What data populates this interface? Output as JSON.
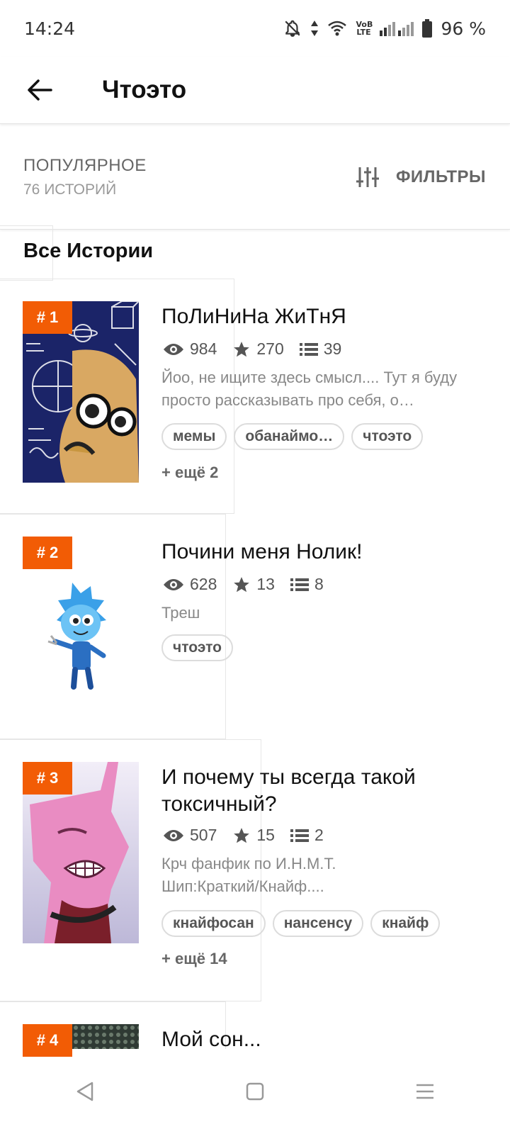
{
  "status_bar": {
    "time": "14:24",
    "battery": "96 %",
    "network_label": "VoB LTE"
  },
  "app_bar": {
    "title": "Чтоэто"
  },
  "sort": {
    "label": "ПОПУЛЯРНОЕ",
    "count": "76 ИСТОРИЙ"
  },
  "filters": {
    "label": "ФИЛЬТРЫ"
  },
  "section_title": "Все Истории",
  "stories": [
    {
      "rank": "# 1",
      "title": "ПоЛиНиНа ЖиТнЯ",
      "views": "984",
      "votes": "270",
      "parts": "39",
      "desc": "Йоо, не ищите здесь смысл.... Тут я буду просто рассказывать про себя, о…",
      "tags": [
        "мемы",
        "обанаймо…",
        "чтоэто"
      ],
      "more": "+ ещё 2"
    },
    {
      "rank": "# 2",
      "title": "Почини меня Нолик!",
      "views": "628",
      "votes": "13",
      "parts": "8",
      "desc": "Треш",
      "tags": [
        "чтоэто"
      ]
    },
    {
      "rank": "# 3",
      "title": "И почему ты всегда такой токсичный?",
      "views": "507",
      "votes": "15",
      "parts": "2",
      "desc": "Крч фанфик по И.Н.М.Т. Шип:Краткий/Кнайф....",
      "tags": [
        "кнайфосан",
        "нансенсу",
        "кнайф"
      ],
      "more": "+ ещё 14"
    },
    {
      "rank": "# 4",
      "title": "Мой сон..."
    }
  ],
  "colors": {
    "accent": "#f25c05",
    "text": "#111111",
    "muted": "#888888"
  },
  "icons": [
    "back-arrow-icon",
    "filter-sliders-icon",
    "eye-icon",
    "star-icon",
    "list-icon",
    "nav-back-icon",
    "nav-home-icon",
    "nav-menu-icon"
  ]
}
